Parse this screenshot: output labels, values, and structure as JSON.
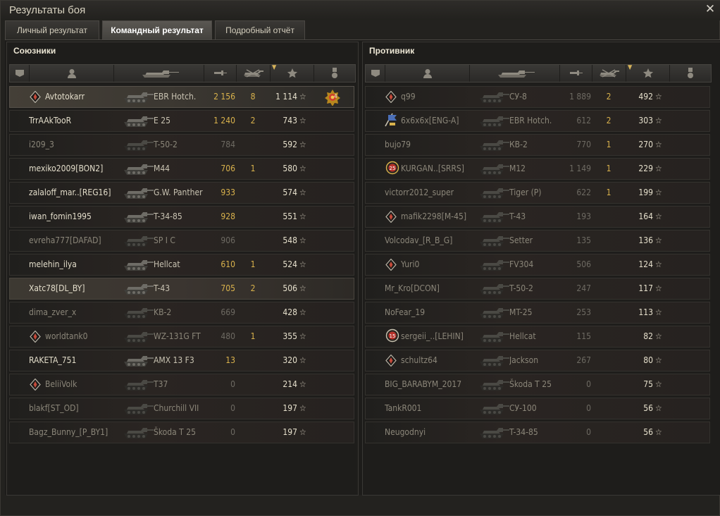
{
  "window": {
    "title": "Результаты боя",
    "close": "✕"
  },
  "tabs": [
    {
      "label": "Личный результат",
      "active": false
    },
    {
      "label": "Командный результат",
      "active": true
    },
    {
      "label": "Подробный отчёт",
      "active": false
    }
  ],
  "allies": {
    "title": "Союзники",
    "rows": [
      {
        "name": "Avtotokarr",
        "badge": "diamond",
        "tank": "EBR Hotch.",
        "damage": "2 156",
        "damage_style": "gold",
        "kills": "8",
        "xp": "1 114",
        "medal": "4",
        "state": "player"
      },
      {
        "name": "TrrAAkTooR",
        "badge": "",
        "tank": "E 25",
        "damage": "1 240",
        "damage_style": "gold",
        "kills": "2",
        "xp": "743",
        "state": "alive"
      },
      {
        "name": "i209_3",
        "badge": "",
        "tank": "T-50-2",
        "damage": "784",
        "damage_style": "grey",
        "kills": "",
        "xp": "592",
        "state": "dead"
      },
      {
        "name": "mexiko2009[BON2]",
        "badge": "",
        "tank": "M44",
        "damage": "706",
        "damage_style": "gold",
        "kills": "1",
        "xp": "580",
        "state": "alive"
      },
      {
        "name": "zalaloff_mar..[REG16]",
        "badge": "",
        "tank": "G.W. Panther",
        "damage": "933",
        "damage_style": "gold",
        "kills": "",
        "xp": "574",
        "state": "alive"
      },
      {
        "name": "iwan_fomin1995",
        "badge": "",
        "tank": "T-34-85",
        "damage": "928",
        "damage_style": "gold",
        "kills": "",
        "xp": "551",
        "state": "alive"
      },
      {
        "name": "evreha777[DAFAD]",
        "badge": "",
        "tank": "SP I C",
        "damage": "906",
        "damage_style": "grey",
        "kills": "",
        "xp": "548",
        "state": "dead"
      },
      {
        "name": "melehin_ilya",
        "badge": "",
        "tank": "Hellcat",
        "damage": "610",
        "damage_style": "gold",
        "kills": "1",
        "xp": "524",
        "state": "alive"
      },
      {
        "name": "Xatc78[DL_BY]",
        "badge": "",
        "tank": "T-43",
        "damage": "705",
        "damage_style": "gold",
        "kills": "2",
        "xp": "506",
        "state": "highlight"
      },
      {
        "name": "dima_zver_x",
        "badge": "",
        "tank": "KB-2",
        "damage": "669",
        "damage_style": "grey",
        "kills": "",
        "xp": "428",
        "state": "dead"
      },
      {
        "name": "worldtank0",
        "badge": "diamond",
        "tank": "WZ-131G FT",
        "damage": "480",
        "damage_style": "grey",
        "kills": "1",
        "xp": "355",
        "state": "dead"
      },
      {
        "name": "RAKETA_751",
        "badge": "",
        "tank": "AMX 13 F3",
        "damage": "13",
        "damage_style": "gold",
        "kills": "",
        "xp": "320",
        "state": "alive"
      },
      {
        "name": "BeliiVolk",
        "badge": "diamond",
        "tank": "T37",
        "damage": "0",
        "damage_style": "grey",
        "kills": "",
        "xp": "214",
        "state": "dead"
      },
      {
        "name": "blakf[ST_OD]",
        "badge": "",
        "tank": "Churchill VII",
        "damage": "0",
        "damage_style": "grey",
        "kills": "",
        "xp": "197",
        "state": "dead"
      },
      {
        "name": "Bagz_Bunny_[P_BY1]",
        "badge": "",
        "tank": "Škoda T 25",
        "damage": "0",
        "damage_style": "grey",
        "kills": "",
        "xp": "197",
        "state": "dead"
      }
    ]
  },
  "enemies": {
    "title": "Противник",
    "rows": [
      {
        "name": "q99",
        "badge": "diamond",
        "tank": "СУ-8",
        "damage": "1 889",
        "damage_style": "grey",
        "kills": "2",
        "xp": "492",
        "state": "dead"
      },
      {
        "name": "6x6x6x[ENG-A]",
        "badge": "flag",
        "tank": "EBR Hotch.",
        "damage": "612",
        "damage_style": "grey",
        "kills": "2",
        "xp": "303",
        "state": "dead"
      },
      {
        "name": "bujo79",
        "badge": "",
        "tank": "КВ-2",
        "damage": "770",
        "damage_style": "grey",
        "kills": "1",
        "xp": "270",
        "state": "dead"
      },
      {
        "name": "KURGAN..[SRRS]",
        "badge": "ring25",
        "tank": "M12",
        "damage": "1 149",
        "damage_style": "grey",
        "kills": "1",
        "xp": "229",
        "state": "dead"
      },
      {
        "name": "victorr2012_super",
        "badge": "",
        "tank": "Tiger (P)",
        "damage": "622",
        "damage_style": "grey",
        "kills": "1",
        "xp": "199",
        "state": "dead"
      },
      {
        "name": "mafik2298[M-45]",
        "badge": "diamond",
        "tank": "T-43",
        "damage": "193",
        "damage_style": "grey",
        "kills": "",
        "xp": "164",
        "state": "dead"
      },
      {
        "name": "Volcodav_[R_B_G]",
        "badge": "",
        "tank": "Setter",
        "damage": "135",
        "damage_style": "grey",
        "kills": "",
        "xp": "136",
        "state": "dead"
      },
      {
        "name": "Yuri0",
        "badge": "diamond",
        "tank": "FV304",
        "damage": "506",
        "damage_style": "grey",
        "kills": "",
        "xp": "124",
        "state": "dead"
      },
      {
        "name": "Mr_Kro[DCON]",
        "badge": "",
        "tank": "T-50-2",
        "damage": "247",
        "damage_style": "grey",
        "kills": "",
        "xp": "117",
        "state": "dead"
      },
      {
        "name": "NoFear_19",
        "badge": "",
        "tank": "MT-25",
        "damage": "253",
        "damage_style": "grey",
        "kills": "",
        "xp": "113",
        "state": "dead"
      },
      {
        "name": "sergeii_..[LEHIN]",
        "badge": "ring15",
        "tank": "Hellcat",
        "damage": "115",
        "damage_style": "grey",
        "kills": "",
        "xp": "82",
        "state": "dead"
      },
      {
        "name": "schultz64",
        "badge": "diamond",
        "tank": "Jackson",
        "damage": "267",
        "damage_style": "grey",
        "kills": "",
        "xp": "80",
        "state": "dead"
      },
      {
        "name": "BIG_BARABYM_2017",
        "badge": "",
        "tank": "Škoda T 25",
        "damage": "0",
        "damage_style": "grey",
        "kills": "",
        "xp": "75",
        "state": "dead"
      },
      {
        "name": "TankR001",
        "badge": "",
        "tank": "СУ-100",
        "damage": "0",
        "damage_style": "grey",
        "kills": "",
        "xp": "56",
        "state": "dead"
      },
      {
        "name": "Neugodnyi",
        "badge": "",
        "tank": "T-34-85",
        "damage": "0",
        "damage_style": "grey",
        "kills": "",
        "xp": "56",
        "state": "dead"
      }
    ]
  },
  "icons": {
    "platoon": "platoon-icon",
    "player": "player-icon",
    "tank": "tank-icon",
    "damage": "damage-icon",
    "kills": "kills-icon",
    "xp": "star-icon",
    "medal": "medal-icon"
  },
  "colors": {
    "gold": "#d9b24c",
    "grey": "#6d6a62",
    "text": "#c9c3b2"
  }
}
